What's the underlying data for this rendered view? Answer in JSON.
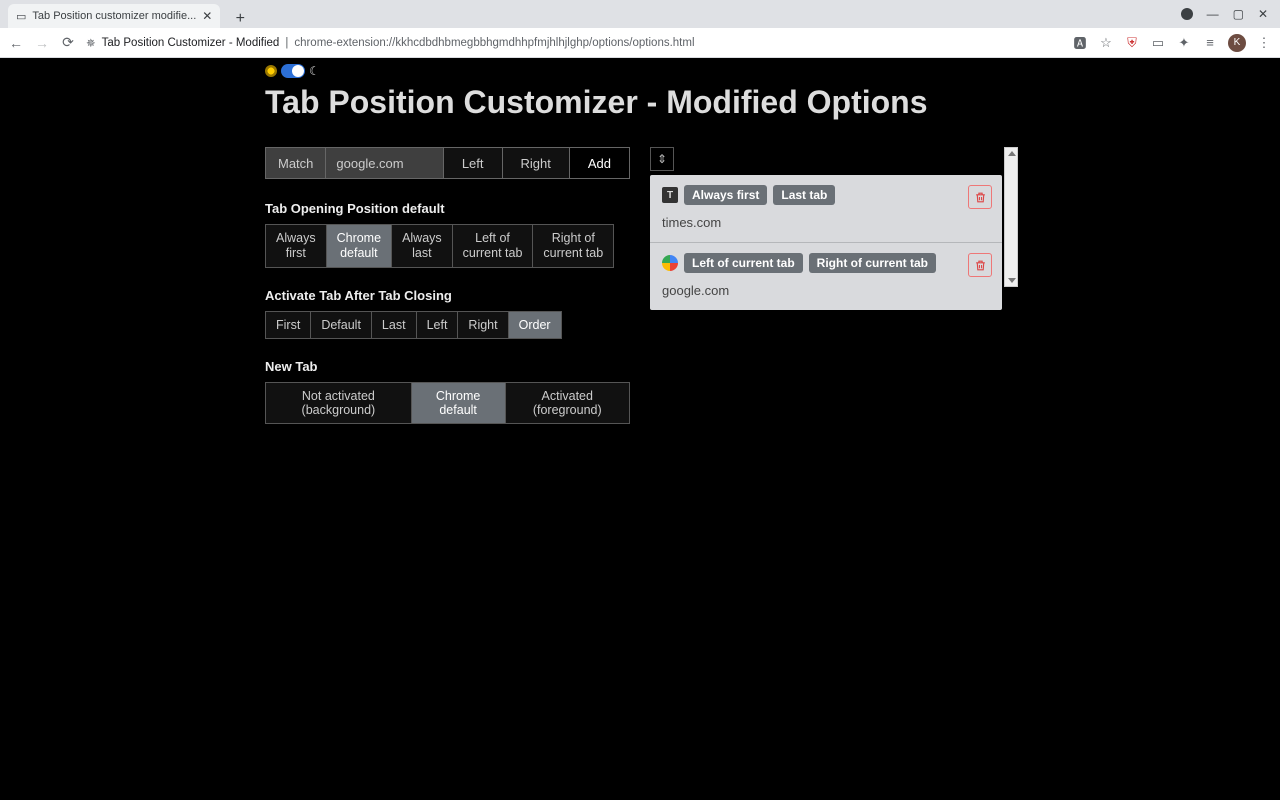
{
  "browser": {
    "tab_title": "Tab Position customizer modifie...",
    "page_title": "Tab Position Customizer - Modified",
    "url": "chrome-extension://kkhcdbdhbmegbbhgmdhhpfmjhlhjlghp/options/options.html",
    "avatar_letter": "K"
  },
  "page": {
    "heading": "Tab Position Customizer - Modified Options",
    "match": {
      "label": "Match",
      "value": "google.com",
      "left": "Left",
      "right": "Right",
      "add": "Add"
    },
    "opening": {
      "title": "Tab Opening Position default",
      "options": [
        "Always first",
        "Chrome default",
        "Always last",
        "Left of current tab",
        "Right of current tab"
      ],
      "active_index": 1
    },
    "closing": {
      "title": "Activate Tab After Tab Closing",
      "options": [
        "First",
        "Default",
        "Last",
        "Left",
        "Right",
        "Order"
      ],
      "active_index": 5
    },
    "newtab": {
      "title": "New Tab",
      "options": [
        "Not activated (background)",
        "Chrome default",
        "Activated (foreground)"
      ],
      "active_index": 1
    },
    "rules": [
      {
        "favicon": "T",
        "pills": [
          "Always first",
          "Last tab"
        ],
        "url": "times.com"
      },
      {
        "favicon": "G",
        "pills": [
          "Left of current tab",
          "Right of current tab"
        ],
        "url": "google.com"
      }
    ]
  }
}
